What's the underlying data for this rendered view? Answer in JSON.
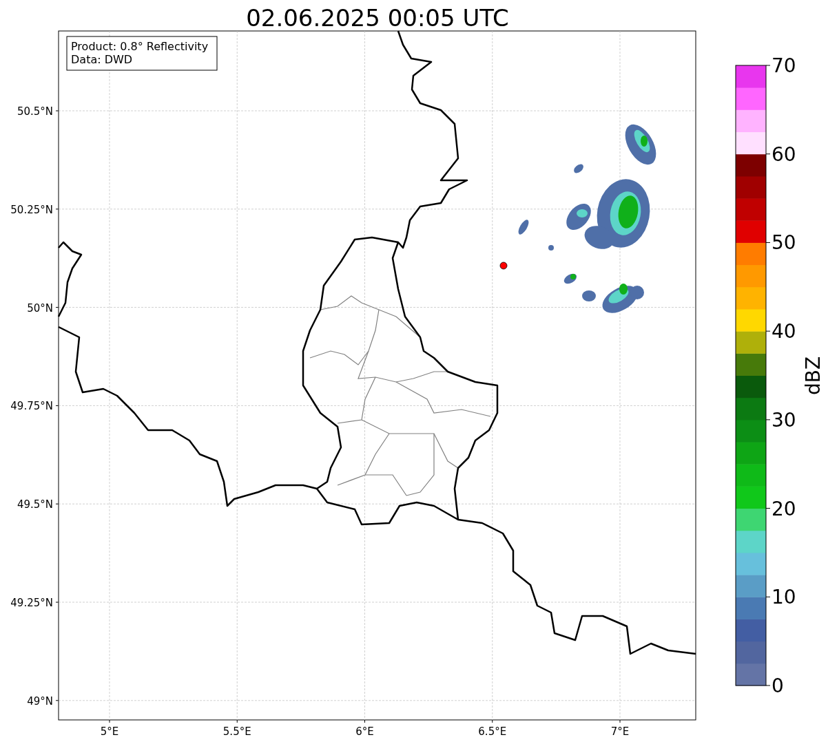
{
  "title": "02.06.2025 00:05 UTC",
  "annotation": [
    "Product: 0.8° Reflectivity",
    "Data: DWD"
  ],
  "x_ticks": [
    "5°E",
    "5.5°E",
    "6°E",
    "6.5°E",
    "7°E"
  ],
  "y_ticks": [
    "50.5°N",
    "50.25°N",
    "50°N",
    "49.75°N",
    "49.5°N",
    "49.25°N",
    "49°N"
  ],
  "colorbar": {
    "label": "dBZ",
    "ticks": [
      "70",
      "60",
      "50",
      "40",
      "30",
      "20",
      "10",
      "0"
    ],
    "bins": [
      {
        "color": "#6474a6"
      },
      {
        "color": "#52669f"
      },
      {
        "color": "#435ea3"
      },
      {
        "color": "#4a7ab3"
      },
      {
        "color": "#5a9dc6"
      },
      {
        "color": "#67c0dc"
      },
      {
        "color": "#5dd5c8"
      },
      {
        "color": "#3ed672"
      },
      {
        "color": "#10c81a"
      },
      {
        "color": "#0fba18"
      },
      {
        "color": "#0ea515"
      },
      {
        "color": "#0c8e15"
      },
      {
        "color": "#0c7a12"
      },
      {
        "color": "#0a5a0c"
      },
      {
        "color": "#477a0a"
      },
      {
        "color": "#afb00a"
      },
      {
        "color": "#ffd800"
      },
      {
        "color": "#ffb300"
      },
      {
        "color": "#ff9900"
      },
      {
        "color": "#ff7c00"
      },
      {
        "color": "#e00000"
      },
      {
        "color": "#c00000"
      },
      {
        "color": "#a00000"
      },
      {
        "color": "#7d0000"
      },
      {
        "color": "#ffe0ff"
      },
      {
        "color": "#ffb3ff"
      },
      {
        "color": "#ff66ff"
      },
      {
        "color": "#e836ee"
      }
    ]
  }
}
